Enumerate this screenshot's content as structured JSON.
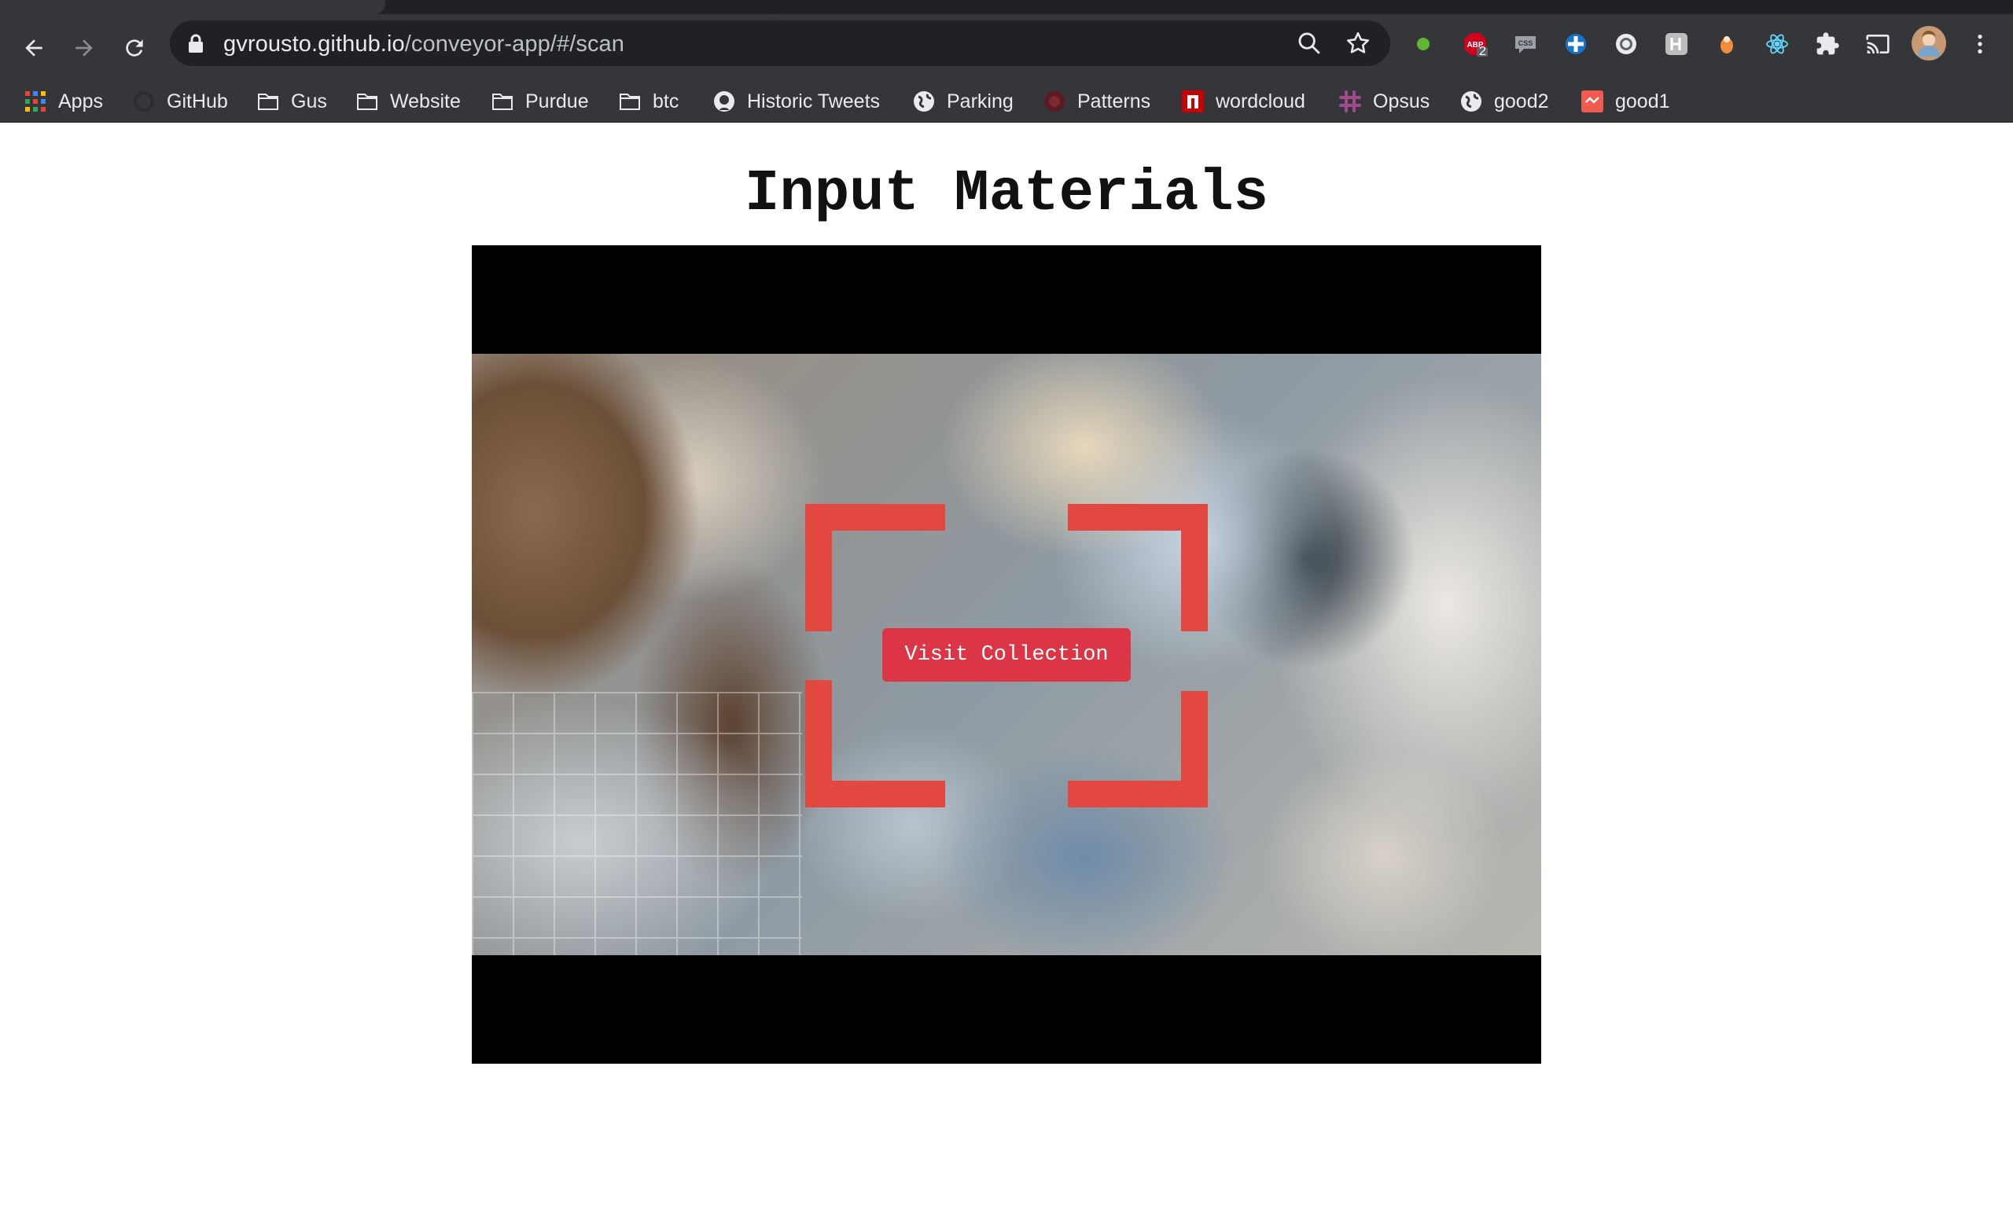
{
  "browser": {
    "address": {
      "host": "gvrousto.github.io",
      "path": "/conveyor-app/#/scan"
    },
    "extensions": [
      {
        "icon": "green-dot-icon"
      },
      {
        "icon": "adblock-icon",
        "badge": "2"
      },
      {
        "icon": "css-viewer-icon"
      },
      {
        "icon": "blue-cross-icon"
      },
      {
        "icon": "circle-extension-icon"
      },
      {
        "icon": "h-extension-icon"
      },
      {
        "icon": "orange-drop-icon"
      },
      {
        "icon": "react-devtools-icon"
      },
      {
        "icon": "extensions-puzzle-icon"
      },
      {
        "icon": "cast-icon"
      },
      {
        "icon": "profile-avatar"
      },
      {
        "icon": "kebab-menu-icon"
      }
    ],
    "bookmarks": [
      {
        "label": "Apps",
        "icon": "apps-grid-icon"
      },
      {
        "label": "GitHub",
        "icon": "github-icon"
      },
      {
        "label": "Gus",
        "icon": "folder-icon"
      },
      {
        "label": "Website",
        "icon": "folder-icon"
      },
      {
        "label": "Purdue",
        "icon": "folder-icon"
      },
      {
        "label": "btc",
        "icon": "folder-icon"
      },
      {
        "label": "Historic Tweets",
        "icon": "github-icon"
      },
      {
        "label": "Parking",
        "icon": "globe-icon"
      },
      {
        "label": "Patterns",
        "icon": "patterns-icon"
      },
      {
        "label": "wordcloud",
        "icon": "wordcloud-icon"
      },
      {
        "label": "Opsus",
        "icon": "slack-icon"
      },
      {
        "label": "good2",
        "icon": "globe-icon"
      },
      {
        "label": "good1",
        "icon": "good1-icon"
      }
    ]
  },
  "page": {
    "title": "Input Materials",
    "scanner": {
      "button_label": "Visit Collection",
      "accent_color": "#e2483f",
      "button_color": "#dc3545"
    }
  },
  "colors": {
    "chrome_toolbar": "#35363a",
    "chrome_omnibox": "#202124",
    "page_bg": "#ffffff"
  }
}
